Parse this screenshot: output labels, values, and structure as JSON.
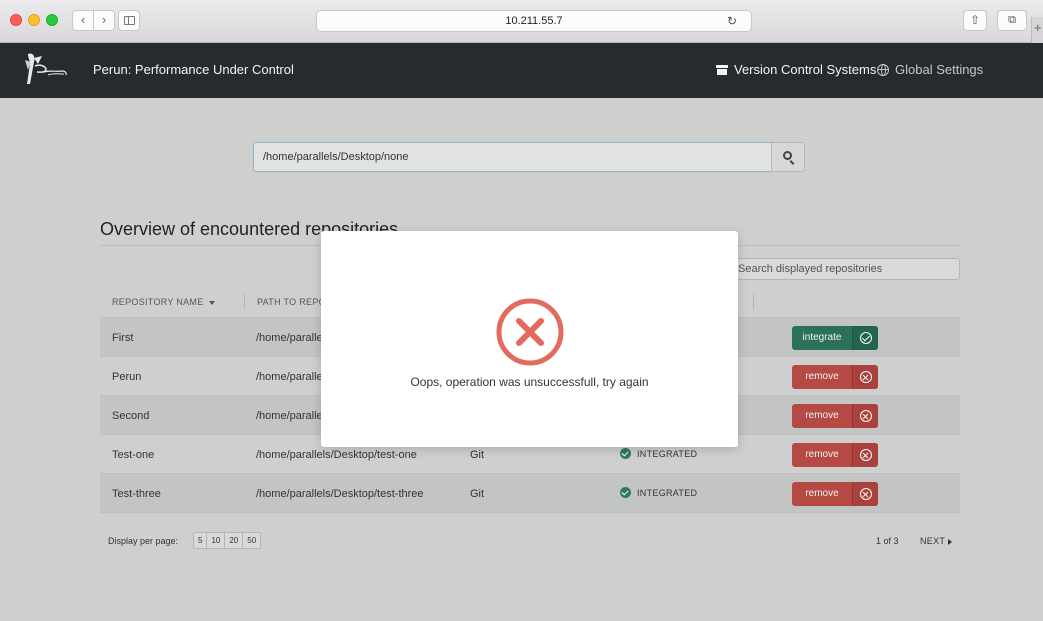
{
  "browser": {
    "url": "10.211.55.7",
    "back_glyph": "‹",
    "forward_glyph": "›",
    "reload_glyph": "↻",
    "share_glyph": "⇧",
    "tabs_glyph": "⧉",
    "newtab_glyph": "+"
  },
  "navbar": {
    "title": "Perun: Performance Under Control",
    "vcs_label": "Version Control Systems",
    "global_label": "Global Settings"
  },
  "search": {
    "value": "/home/parallels/Desktop/none"
  },
  "overview": {
    "title": "Overview of encountered repositories",
    "filter_placeholder": "Search displayed repositories"
  },
  "table": {
    "headers": {
      "name": "REPOSITORY NAME",
      "path": "PATH TO REPO"
    },
    "rows": [
      {
        "name": "First",
        "path": "/home/paralle",
        "vcs": "",
        "status": "",
        "action": "integrate"
      },
      {
        "name": "Perun",
        "path": "/home/paralle",
        "vcs": "",
        "status": "",
        "action": "remove"
      },
      {
        "name": "Second",
        "path": "/home/paralle",
        "vcs": "",
        "status": "",
        "action": "remove"
      },
      {
        "name": "Test-one",
        "path": "/home/parallels/Desktop/test-one",
        "vcs": "Git",
        "status": "INTEGRATED",
        "action": "remove"
      },
      {
        "name": "Test-three",
        "path": "/home/parallels/Desktop/test-three",
        "vcs": "Git",
        "status": "INTEGRATED",
        "action": "remove"
      }
    ]
  },
  "pagination": {
    "per_page_label": "Display per page:",
    "options": [
      "5",
      "10",
      "20",
      "50"
    ],
    "info": "1  of  3",
    "next_label": "NEXT"
  },
  "modal": {
    "message": "Oops, operation was unsuccessfull, try again"
  },
  "colors": {
    "navbar": "#262c2e",
    "remove": "#b54a44",
    "integrate": "#2a705a",
    "error": "#e26a5f"
  }
}
